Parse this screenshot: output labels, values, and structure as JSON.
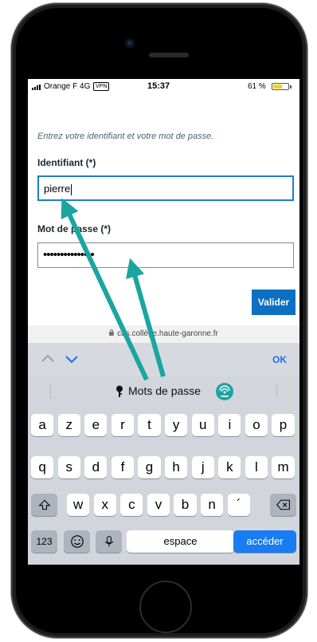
{
  "status": {
    "carrier": "Orange F  4G",
    "vpn": "VPN",
    "time": "15:37",
    "battery_pct": "61 %",
    "battery_level": 0.61,
    "battery_color": "#f5d400"
  },
  "form": {
    "instruction": "Entrez votre identifiant et votre mot de passe.",
    "username_label": "Identifiant  (*)",
    "username_value": "pierre",
    "password_label": "Mot de passe (*)",
    "password_value": "•••••••••••••••",
    "submit_label": "Valider"
  },
  "url": "cas.collège.haute-garonne.fr",
  "accessory": {
    "ok_label": "OK"
  },
  "keyboard": {
    "passwords_label": "Mots de passe",
    "row1": [
      "a",
      "z",
      "e",
      "r",
      "t",
      "y",
      "u",
      "i",
      "o",
      "p"
    ],
    "row2": [
      "q",
      "s",
      "d",
      "f",
      "g",
      "h",
      "j",
      "k",
      "l",
      "m"
    ],
    "row3": [
      "w",
      "x",
      "c",
      "v",
      "b",
      "n",
      "´"
    ],
    "numbers_label": "123",
    "space_label": "espace",
    "go_label": "accéder"
  },
  "colors": {
    "accent": "#0c6fc2",
    "annotation_arrow": "#1aa5a0"
  }
}
